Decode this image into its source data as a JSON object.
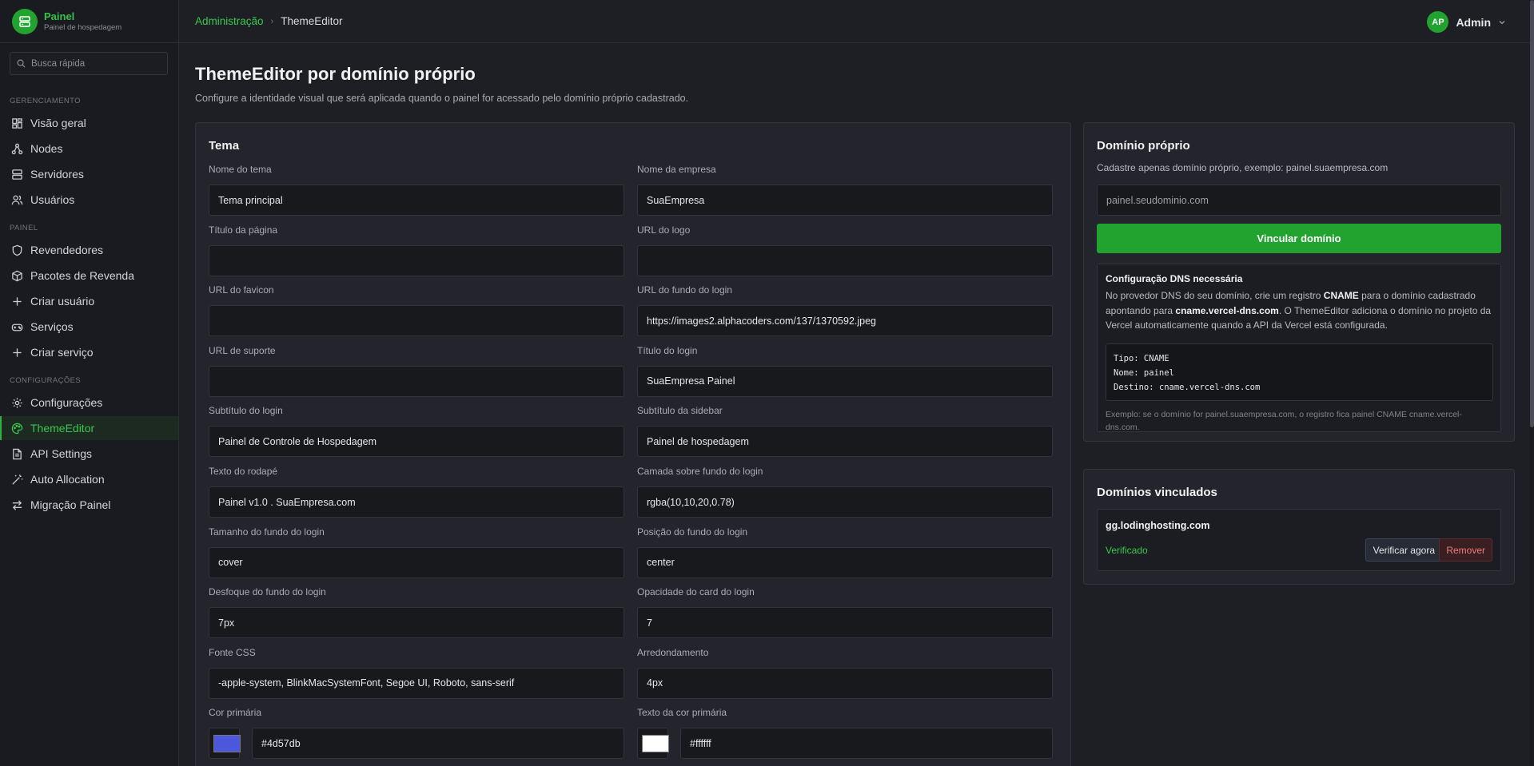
{
  "brand": {
    "title": "Painel",
    "subtitle": "Painel de hospedagem"
  },
  "search": {
    "placeholder": "Busca rápida"
  },
  "sidebar": {
    "sections": [
      {
        "label": "GERENCIAMENTO",
        "items": [
          "Visão geral",
          "Nodes",
          "Servidores",
          "Usuários"
        ]
      },
      {
        "label": "PAINEL",
        "items": [
          "Revendedores",
          "Pacotes de Revenda",
          "Criar usuário",
          "Serviços",
          "Criar serviço"
        ]
      },
      {
        "label": "CONFIGURAÇÕES",
        "items": [
          "Configurações",
          "ThemeEditor",
          "API Settings",
          "Auto Allocation",
          "Migração Painel"
        ]
      }
    ],
    "active": "ThemeEditor"
  },
  "breadcrumb": {
    "parent": "Administração",
    "separator": "›",
    "current": "ThemeEditor"
  },
  "user": {
    "initials": "AP",
    "name": "Admin"
  },
  "page": {
    "title": "ThemeEditor por domínio próprio",
    "subtitle": "Configure a identidade visual que será aplicada quando o painel for acessado pelo domínio próprio cadastrado."
  },
  "theme": {
    "title": "Tema",
    "fields": [
      {
        "label": "Nome do tema",
        "value": "Tema principal"
      },
      {
        "label": "Nome da empresa",
        "value": "SuaEmpresa"
      },
      {
        "label": "Título da página",
        "value": ""
      },
      {
        "label": "URL do logo",
        "value": ""
      },
      {
        "label": "URL do favicon",
        "value": ""
      },
      {
        "label": "URL do fundo do login",
        "value": "https://images2.alphacoders.com/137/1370592.jpeg"
      },
      {
        "label": "URL de suporte",
        "value": ""
      },
      {
        "label": "Título do login",
        "value": "SuaEmpresa Painel"
      },
      {
        "label": "Subtítulo do login",
        "value": "Painel de Controle de Hospedagem"
      },
      {
        "label": "Subtítulo da sidebar",
        "value": "Painel de hospedagem"
      },
      {
        "label": "Texto do rodapé",
        "value": "Painel v1.0 . SuaEmpresa.com"
      },
      {
        "label": "Camada sobre fundo do login",
        "value": "rgba(10,10,20,0.78)"
      },
      {
        "label": "Tamanho do fundo do login",
        "value": "cover"
      },
      {
        "label": "Posição do fundo do login",
        "value": "center"
      },
      {
        "label": "Desfoque do fundo do login",
        "value": "7px"
      },
      {
        "label": "Opacidade do card do login",
        "value": "7"
      },
      {
        "label": "Fonte CSS",
        "value": "-apple-system, BlinkMacSystemFont, Segoe UI, Roboto, sans-serif"
      },
      {
        "label": "Arredondamento",
        "value": "4px"
      },
      {
        "label": "Cor primária",
        "value": "#4d57db",
        "swatch": "#4d57db"
      },
      {
        "label": "Texto da cor primária",
        "value": "#ffffff",
        "swatch": "#ffffff"
      }
    ]
  },
  "domain": {
    "title": "Domínio próprio",
    "hint": "Cadastre apenas domínio próprio, exemplo: painel.suaempresa.com",
    "placeholder": "painel.seudominio.com",
    "button": "Vincular domínio",
    "dns": {
      "title": "Configuração DNS necessária",
      "desc_1": "No provedor DNS do seu domínio, crie um registro ",
      "desc_cname": "CNAME",
      "desc_2": " para o domínio cadastrado apontando para ",
      "desc_target": "cname.vercel-dns.com",
      "desc_3": ". O ThemeEditor adiciona o domínio no projeto da Vercel automaticamente quando a API da Vercel está configurada.",
      "code_lines": [
        "Tipo: CNAME",
        "Nome: painel",
        "Destino: cname.vercel-dns.com"
      ],
      "example": "Exemplo: se o domínio for painel.suaempresa.com, o registro fica painel CNAME cname.vercel-dns.com."
    }
  },
  "linked": {
    "title": "Domínios vinculados",
    "items": [
      {
        "domain": "gg.lodinghosting.com",
        "status": "Verificado",
        "verify": "Verificar agora",
        "remove": "Remover"
      }
    ]
  },
  "colors": {
    "accent": "#22a32f",
    "accent_text": "#38c84d",
    "danger": "#f07a7a"
  }
}
